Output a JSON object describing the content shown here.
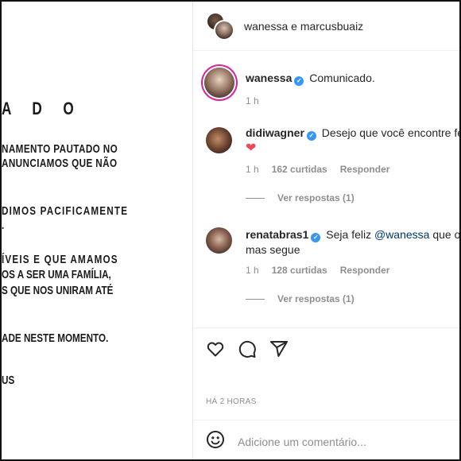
{
  "post_image": {
    "title": "A D O",
    "lines": [
      "NAMENTO PAUTADO NO",
      "ANUNCIAMOS QUE NÃO",
      "DIMOS PACIFICAMENTE",
      ".",
      "ÍVEIS E QUE AMAMOS",
      "OS A SER UMA FAMÍLIA,",
      "S QUE NOS UNIRAM ATÉ",
      "ADE NESTE MOMENTO.",
      "US"
    ]
  },
  "header": {
    "title": "wanessa e marcusbuaiz"
  },
  "comments": [
    {
      "username": "wanessa",
      "verified": true,
      "text": "Comunicado.",
      "time": "1 h"
    },
    {
      "username": "didiwagner",
      "verified": true,
      "text": "Desejo que você encontre feli",
      "heart": "❤",
      "time": "1 h",
      "likes": "162 curtidas",
      "reply_label": "Responder",
      "view_replies": "Ver respostas (1)"
    },
    {
      "username": "renatabras1",
      "verified": true,
      "text_before": "Seja feliz ",
      "mention": "@wanessa",
      "text_after": " que o am",
      "text_line2": "mas segue",
      "time": "1 h",
      "likes": "128 curtidas",
      "reply_label": "Responder",
      "view_replies": "Ver respostas (1)"
    }
  ],
  "actions": {
    "icons": [
      "heart-icon",
      "comment-icon",
      "share-icon"
    ]
  },
  "timestamp": "HÁ 2 HORAS",
  "add_comment": {
    "placeholder": "Adicione um comentário...",
    "icon": "emoji-icon"
  },
  "colors": {
    "verified": "#3897f0",
    "mention": "#00376b",
    "muted": "#8e8e8e",
    "heart": "#ed4956"
  }
}
